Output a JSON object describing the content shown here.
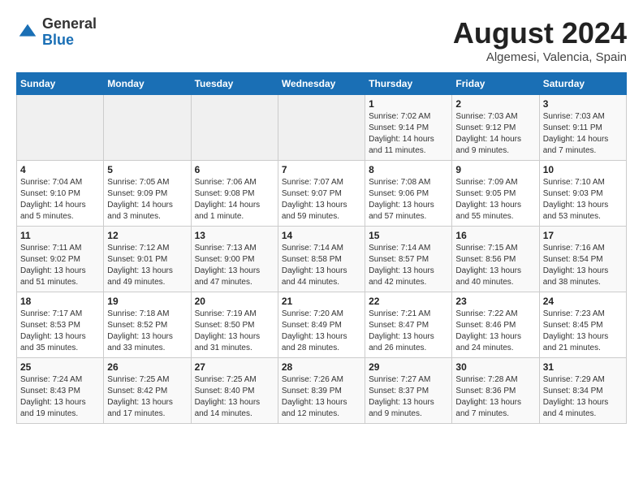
{
  "header": {
    "logo": {
      "general": "General",
      "blue": "Blue"
    },
    "title": "August 2024",
    "subtitle": "Algemesi, Valencia, Spain"
  },
  "weekdays": [
    "Sunday",
    "Monday",
    "Tuesday",
    "Wednesday",
    "Thursday",
    "Friday",
    "Saturday"
  ],
  "weeks": [
    [
      {
        "day": "",
        "detail": ""
      },
      {
        "day": "",
        "detail": ""
      },
      {
        "day": "",
        "detail": ""
      },
      {
        "day": "",
        "detail": ""
      },
      {
        "day": "1",
        "detail": "Sunrise: 7:02 AM\nSunset: 9:14 PM\nDaylight: 14 hours\nand 11 minutes."
      },
      {
        "day": "2",
        "detail": "Sunrise: 7:03 AM\nSunset: 9:12 PM\nDaylight: 14 hours\nand 9 minutes."
      },
      {
        "day": "3",
        "detail": "Sunrise: 7:03 AM\nSunset: 9:11 PM\nDaylight: 14 hours\nand 7 minutes."
      }
    ],
    [
      {
        "day": "4",
        "detail": "Sunrise: 7:04 AM\nSunset: 9:10 PM\nDaylight: 14 hours\nand 5 minutes."
      },
      {
        "day": "5",
        "detail": "Sunrise: 7:05 AM\nSunset: 9:09 PM\nDaylight: 14 hours\nand 3 minutes."
      },
      {
        "day": "6",
        "detail": "Sunrise: 7:06 AM\nSunset: 9:08 PM\nDaylight: 14 hours\nand 1 minute."
      },
      {
        "day": "7",
        "detail": "Sunrise: 7:07 AM\nSunset: 9:07 PM\nDaylight: 13 hours\nand 59 minutes."
      },
      {
        "day": "8",
        "detail": "Sunrise: 7:08 AM\nSunset: 9:06 PM\nDaylight: 13 hours\nand 57 minutes."
      },
      {
        "day": "9",
        "detail": "Sunrise: 7:09 AM\nSunset: 9:05 PM\nDaylight: 13 hours\nand 55 minutes."
      },
      {
        "day": "10",
        "detail": "Sunrise: 7:10 AM\nSunset: 9:03 PM\nDaylight: 13 hours\nand 53 minutes."
      }
    ],
    [
      {
        "day": "11",
        "detail": "Sunrise: 7:11 AM\nSunset: 9:02 PM\nDaylight: 13 hours\nand 51 minutes."
      },
      {
        "day": "12",
        "detail": "Sunrise: 7:12 AM\nSunset: 9:01 PM\nDaylight: 13 hours\nand 49 minutes."
      },
      {
        "day": "13",
        "detail": "Sunrise: 7:13 AM\nSunset: 9:00 PM\nDaylight: 13 hours\nand 47 minutes."
      },
      {
        "day": "14",
        "detail": "Sunrise: 7:14 AM\nSunset: 8:58 PM\nDaylight: 13 hours\nand 44 minutes."
      },
      {
        "day": "15",
        "detail": "Sunrise: 7:14 AM\nSunset: 8:57 PM\nDaylight: 13 hours\nand 42 minutes."
      },
      {
        "day": "16",
        "detail": "Sunrise: 7:15 AM\nSunset: 8:56 PM\nDaylight: 13 hours\nand 40 minutes."
      },
      {
        "day": "17",
        "detail": "Sunrise: 7:16 AM\nSunset: 8:54 PM\nDaylight: 13 hours\nand 38 minutes."
      }
    ],
    [
      {
        "day": "18",
        "detail": "Sunrise: 7:17 AM\nSunset: 8:53 PM\nDaylight: 13 hours\nand 35 minutes."
      },
      {
        "day": "19",
        "detail": "Sunrise: 7:18 AM\nSunset: 8:52 PM\nDaylight: 13 hours\nand 33 minutes."
      },
      {
        "day": "20",
        "detail": "Sunrise: 7:19 AM\nSunset: 8:50 PM\nDaylight: 13 hours\nand 31 minutes."
      },
      {
        "day": "21",
        "detail": "Sunrise: 7:20 AM\nSunset: 8:49 PM\nDaylight: 13 hours\nand 28 minutes."
      },
      {
        "day": "22",
        "detail": "Sunrise: 7:21 AM\nSunset: 8:47 PM\nDaylight: 13 hours\nand 26 minutes."
      },
      {
        "day": "23",
        "detail": "Sunrise: 7:22 AM\nSunset: 8:46 PM\nDaylight: 13 hours\nand 24 minutes."
      },
      {
        "day": "24",
        "detail": "Sunrise: 7:23 AM\nSunset: 8:45 PM\nDaylight: 13 hours\nand 21 minutes."
      }
    ],
    [
      {
        "day": "25",
        "detail": "Sunrise: 7:24 AM\nSunset: 8:43 PM\nDaylight: 13 hours\nand 19 minutes."
      },
      {
        "day": "26",
        "detail": "Sunrise: 7:25 AM\nSunset: 8:42 PM\nDaylight: 13 hours\nand 17 minutes."
      },
      {
        "day": "27",
        "detail": "Sunrise: 7:25 AM\nSunset: 8:40 PM\nDaylight: 13 hours\nand 14 minutes."
      },
      {
        "day": "28",
        "detail": "Sunrise: 7:26 AM\nSunset: 8:39 PM\nDaylight: 13 hours\nand 12 minutes."
      },
      {
        "day": "29",
        "detail": "Sunrise: 7:27 AM\nSunset: 8:37 PM\nDaylight: 13 hours\nand 9 minutes."
      },
      {
        "day": "30",
        "detail": "Sunrise: 7:28 AM\nSunset: 8:36 PM\nDaylight: 13 hours\nand 7 minutes."
      },
      {
        "day": "31",
        "detail": "Sunrise: 7:29 AM\nSunset: 8:34 PM\nDaylight: 13 hours\nand 4 minutes."
      }
    ]
  ]
}
